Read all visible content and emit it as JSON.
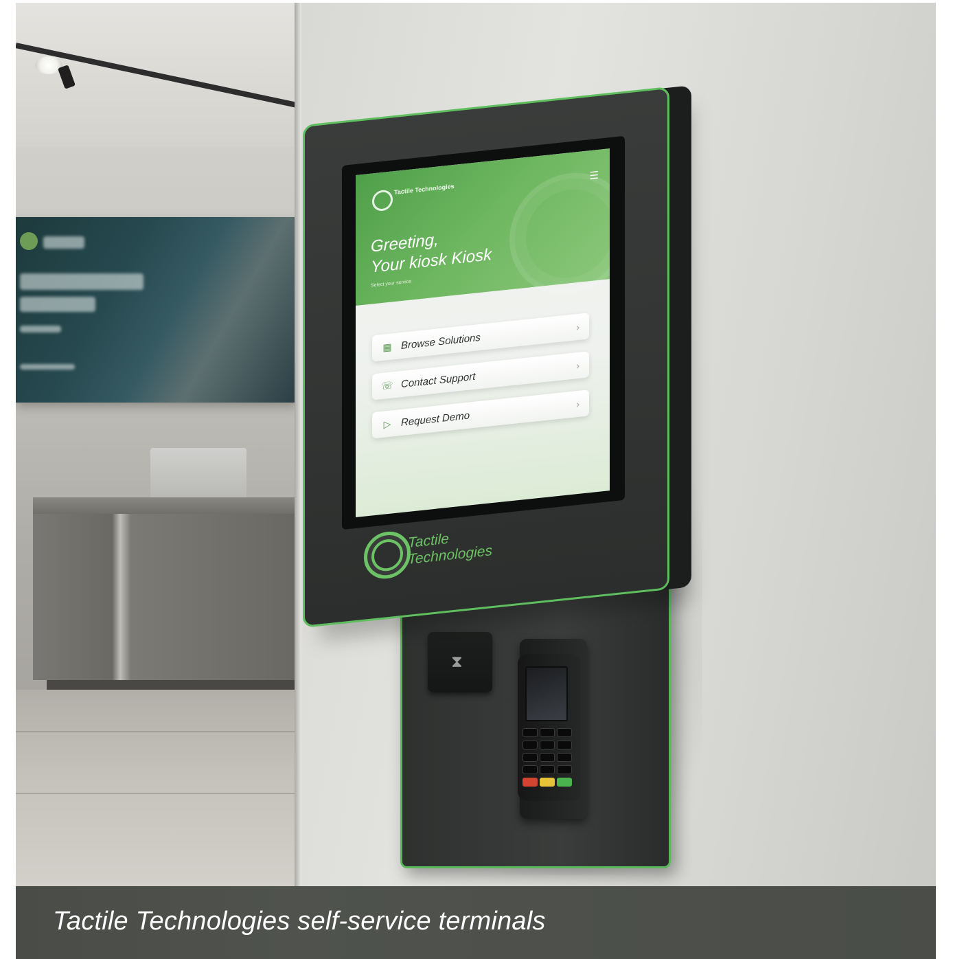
{
  "colors": {
    "brand_green": "#5fbf5f",
    "kiosk_body": "#333534",
    "caption_bar": "#4f524d",
    "caption_text": "#ffffff"
  },
  "kiosk_screen": {
    "logo_text": "Tactile Technologies",
    "menu_icon": "hamburger-menu-icon",
    "title_line1": "Greeting,",
    "title_line2": "Your kiosk Kiosk",
    "subtitle": "Select your service",
    "buttons": [
      {
        "label": "Browse Solutions",
        "icon": "grid-icon"
      },
      {
        "label": "Contact Support",
        "icon": "headset-icon"
      },
      {
        "label": "Request Demo",
        "icon": "play-icon"
      }
    ]
  },
  "kiosk_brand": {
    "line1": "Tactile",
    "line2": "Technologies"
  },
  "hardware": {
    "nfc_icon": "contactless-icon",
    "payment_keys": [
      "red",
      "yellow",
      "green"
    ]
  },
  "caption": {
    "text": "Tactile Technologies self-service terminals"
  }
}
